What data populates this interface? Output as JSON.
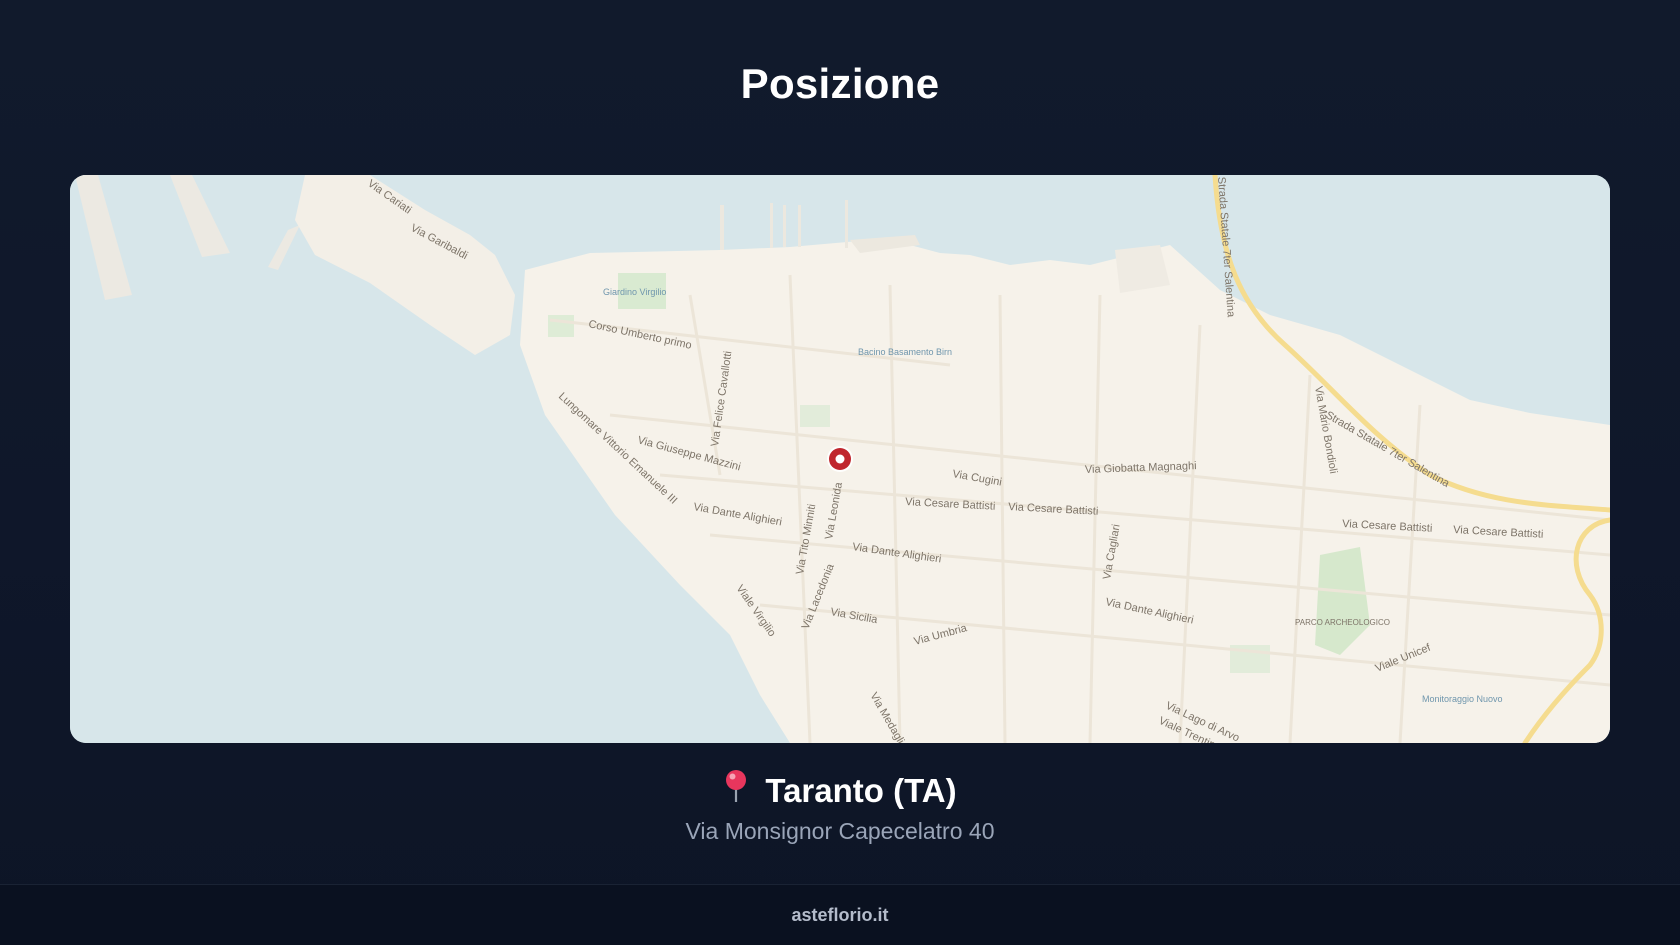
{
  "page": {
    "title": "Posizione"
  },
  "map": {
    "street_labels": [
      "Via Cariati",
      "Via Garibaldi",
      "Corso Umberto primo",
      "Via Felice Cavallotti",
      "Lungomare Vittorio Emanuele III",
      "Via Giuseppe Mazzini",
      "Via Dante Alighieri",
      "Via Tito Minniti",
      "Via Leonida",
      "Via Cugini",
      "Via Giobatta Magnaghi",
      "Via Cesare Battisti",
      "Via Cesare Battisti",
      "Via Cesare Battisti",
      "Via Cesare Battisti",
      "Via Dante Alighieri",
      "Via Cagliari",
      "Via Dante Alighieri",
      "Viale Virgilio",
      "Via Lacedonia",
      "Via Sicilia",
      "Via Umbria",
      "Via Medaglie d'Oro",
      "Via Lago di Arvo",
      "Viale Trentino",
      "Viale Unicef",
      "Via Mario Bondioli",
      "Strada Statale 7ter Salentina",
      "Strada Statale 7ter Salentina"
    ],
    "poi_labels": [
      "Giardino Virgilio",
      "Bacino Basamento Birn",
      "PARCO ARCHEOLOGICO",
      "Monitoraggio Nuovo"
    ],
    "marker_color": "#c0262d",
    "water_color": "#d7e6ea",
    "land_color": "#f6f2ea"
  },
  "location": {
    "pin_icon": "round-pushpin-icon",
    "city": "Taranto (TA)",
    "address": "Via Monsignor Capecelatro 40"
  },
  "footer": {
    "site": "asteflorio.it"
  }
}
